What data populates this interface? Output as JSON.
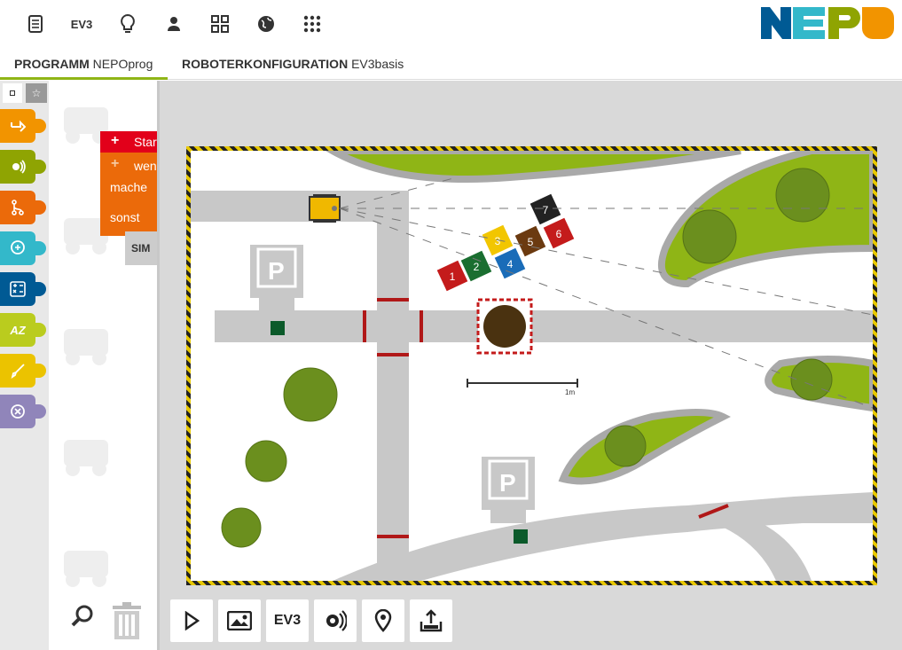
{
  "topbar": {
    "icons": [
      "document-icon",
      "ev3-icon",
      "lightbulb-icon",
      "user-icon",
      "grid-icon",
      "globe-icon",
      "apps-icon"
    ],
    "ev3_label": "EV3"
  },
  "tabs": [
    {
      "bold": "PROGRAMM",
      "name": "NEPOprog"
    },
    {
      "bold": "ROBOTERKONFIGURATION",
      "name": "EV3basis"
    }
  ],
  "categories": [
    {
      "name": "action",
      "color": "#f29400"
    },
    {
      "name": "sensors",
      "color": "#8fa402"
    },
    {
      "name": "control",
      "color": "#eb6a0a"
    },
    {
      "name": "logic",
      "color": "#33b8ca"
    },
    {
      "name": "math",
      "color": "#005a94"
    },
    {
      "name": "text",
      "color": "#bacc1e"
    },
    {
      "name": "colour",
      "color": "#ebc300"
    },
    {
      "name": "communication",
      "color": "#9085ba"
    }
  ],
  "blocks": {
    "start": "Start",
    "if": "wenn",
    "do": "mache",
    "else": "sonst",
    "sim": "SIM"
  },
  "field": {
    "scale_label": "1m",
    "numbers": [
      "1",
      "2",
      "3",
      "4",
      "5",
      "6",
      "7"
    ]
  },
  "bottom_buttons": [
    "play-icon",
    "image-icon",
    "ev3-icon",
    "sensor-icon",
    "location-icon",
    "export-icon"
  ],
  "bottom_ev3_label": "EV3"
}
